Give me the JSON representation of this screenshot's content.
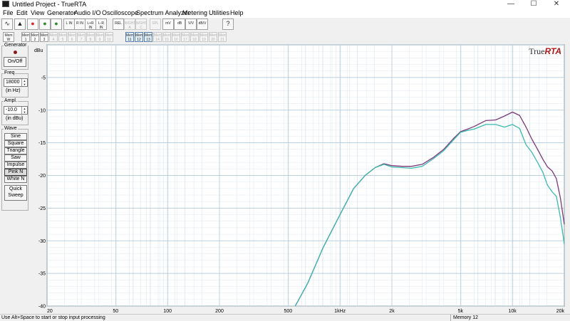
{
  "window": {
    "title": "Untitled Project - TrueRTA",
    "minimize": "—",
    "maximize": "☐",
    "close": "✕"
  },
  "menu": [
    "File",
    "Edit",
    "View",
    "Generator",
    "Audio I/O",
    "Oscilloscope",
    "Spectrum Analyzer",
    "Metering",
    "Utilities",
    "Help"
  ],
  "toolbar_row1": [
    {
      "name": "scope-icon",
      "glyph": "∿"
    },
    {
      "name": "spectrum-icon",
      "glyph": "▲"
    },
    {
      "name": "record-icon",
      "glyph": "●",
      "color": "#d42b2b"
    },
    {
      "name": "stop-icon",
      "glyph": "●",
      "color": "#2a8f2a"
    },
    {
      "name": "go-icon",
      "glyph": "●",
      "color": "#2a8f2a"
    },
    {
      "label": "L IN"
    },
    {
      "label": "R IN"
    },
    {
      "label": "L+R IN"
    },
    {
      "label": "L-R IN"
    },
    {
      "label": "REL"
    },
    {
      "label": "WGHT A"
    },
    {
      "label": "WGHT C"
    },
    {
      "label": "SPL"
    },
    {
      "label": "mV"
    },
    {
      "label": "dB"
    },
    {
      "label": "V/V"
    },
    {
      "label": "dB/V"
    },
    {
      "name": "help-pointer-icon",
      "glyph": "?"
    }
  ],
  "toolbar_row2": [
    "Mem W",
    "Mem 1",
    "Mem 2",
    "Mem 3",
    "Mem 4",
    "Mem 5",
    "Mem 6",
    "Mem 7",
    "Mem 8",
    "Mem 9",
    "Mem 10",
    "Mem 11",
    "Mem 12",
    "Mem 13",
    "Mem 14",
    "Mem 15",
    "Mem 16",
    "Mem 17",
    "Mem 18",
    "Mem 19",
    "Mem 20",
    "Mem 21"
  ],
  "generator": {
    "title": "Generator",
    "onoff": "On/Off",
    "freq_label": "Freq",
    "freq_value": "18000",
    "freq_unit": "(in Hz)",
    "ampl_label": "Ampl.",
    "ampl_value": "-10.0",
    "ampl_unit": "(in dBu)",
    "wave_label": "Wave",
    "waves": [
      "Sine",
      "Square",
      "Triangle",
      "Saw",
      "Impulse",
      "Pink N",
      "White N"
    ],
    "selected_wave": "Pink N",
    "quick_sweep_1": "Quick",
    "quick_sweep_2": "Sweep"
  },
  "chart_data": {
    "type": "line",
    "brand": "True",
    "brand_bold": "RTA",
    "ylabel": "dBu",
    "ylim": [
      -40,
      0
    ],
    "y_ticks": [
      0,
      -5,
      -10,
      -15,
      -20,
      -25,
      -30,
      -35,
      -40
    ],
    "y_tick_labels": [
      "",
      "-5",
      "-10",
      "-15",
      "-20",
      "-25",
      "-30",
      "-35",
      "-40"
    ],
    "xscale": "log",
    "xlim": [
      20,
      20000
    ],
    "x_ticks": [
      20,
      50,
      100,
      200,
      500,
      1000,
      2000,
      5000,
      10000,
      20000
    ],
    "x_tick_labels": [
      "20",
      "50",
      "100",
      "200",
      "500",
      "1kHz",
      "2k",
      "5k",
      "10k",
      "20k"
    ],
    "grid": true,
    "series": [
      {
        "color": "#7b3a7b",
        "x": [
          550,
          650,
          800,
          1000,
          1200,
          1400,
          1600,
          1800,
          2000,
          2300,
          2600,
          3000,
          3500,
          4000,
          4500,
          5000,
          5500,
          6000,
          7000,
          8000,
          9000,
          10000,
          11000,
          12000,
          13000,
          14000,
          15000,
          16000,
          17000,
          18000,
          19000,
          20000
        ],
        "y": [
          -40,
          -36.5,
          -31,
          -26,
          -22,
          -20,
          -18.8,
          -18.2,
          -18.5,
          -18.6,
          -18.6,
          -18.3,
          -17.2,
          -16,
          -14.5,
          -13.3,
          -12.9,
          -12.5,
          -11.6,
          -11.5,
          -10.9,
          -10.3,
          -10.8,
          -12.6,
          -14.5,
          -16,
          -17.5,
          -18.7,
          -19.3,
          -20.5,
          -23.5,
          -27.5
        ]
      },
      {
        "color": "#3cb8b0",
        "x": [
          550,
          650,
          800,
          1000,
          1200,
          1400,
          1600,
          1800,
          2000,
          2300,
          2600,
          3000,
          3500,
          4000,
          4500,
          5000,
          5500,
          6000,
          7000,
          8000,
          9000,
          10000,
          11000,
          12000,
          13000,
          14000,
          15000,
          16000,
          17000,
          18000,
          19000,
          20000
        ],
        "y": [
          -40,
          -36.5,
          -31,
          -26,
          -22,
          -20,
          -18.8,
          -18.3,
          -18.7,
          -18.8,
          -18.9,
          -18.6,
          -17.4,
          -16.2,
          -14.7,
          -13.4,
          -13.1,
          -12.9,
          -12.2,
          -12.2,
          -12.6,
          -12.2,
          -12.8,
          -15.3,
          -16.5,
          -18,
          -19.5,
          -21.5,
          -22.5,
          -23.2,
          -26.5,
          -30.5
        ]
      }
    ]
  },
  "status": {
    "hint": "Use Alt+Space to start or stop input processing",
    "memory": "Memory 12"
  }
}
